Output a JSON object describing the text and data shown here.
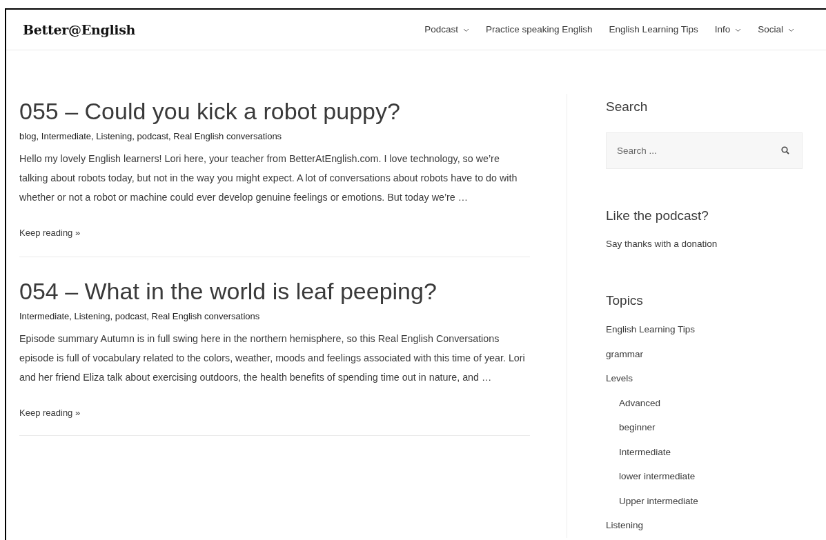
{
  "header": {
    "logo": "Better@English",
    "nav": [
      {
        "label": "Podcast",
        "dropdown": true
      },
      {
        "label": "Practice speaking English",
        "dropdown": false
      },
      {
        "label": "English Learning Tips",
        "dropdown": false
      },
      {
        "label": "Info",
        "dropdown": true
      },
      {
        "label": "Social",
        "dropdown": true
      }
    ]
  },
  "posts": [
    {
      "title": "055 – Could you kick a robot puppy?",
      "categories": "blog, Intermediate, Listening, podcast, Real English conversations",
      "excerpt": "Hello my lovely English learners! Lori here, your teacher from BetterAtEnglish.com. I love technology, so we’re talking about robots today, but not in the way you might expect. A lot of conversations about robots have to do with whether or not a robot or machine could ever develop genuine feelings or emotions. But today we’re …",
      "more": "Keep reading »"
    },
    {
      "title": "054 – What in the world is leaf peeping?",
      "categories": "Intermediate, Listening, podcast, Real English conversations",
      "excerpt": "Episode summary Autumn is in full swing here in the northern hemisphere, so this Real English Conversations episode is full of vocabulary related to the colors, weather, moods and feelings associated with this time of year. Lori and her friend Eliza talk about exercising outdoors, the health benefits of spending time out in nature, and …",
      "more": "Keep reading »"
    }
  ],
  "sidebar": {
    "search": {
      "title": "Search",
      "placeholder": "Search ..."
    },
    "donate": {
      "title": "Like the podcast?",
      "link": "Say thanks with a donation"
    },
    "topics": {
      "title": "Topics",
      "items": [
        {
          "label": "English Learning Tips"
        },
        {
          "label": "grammar"
        },
        {
          "label": "Levels",
          "children": [
            {
              "label": "Advanced"
            },
            {
              "label": "beginner"
            },
            {
              "label": "Intermediate"
            },
            {
              "label": "lower intermediate"
            },
            {
              "label": "Upper intermediate"
            }
          ]
        },
        {
          "label": "Listening"
        }
      ]
    }
  }
}
